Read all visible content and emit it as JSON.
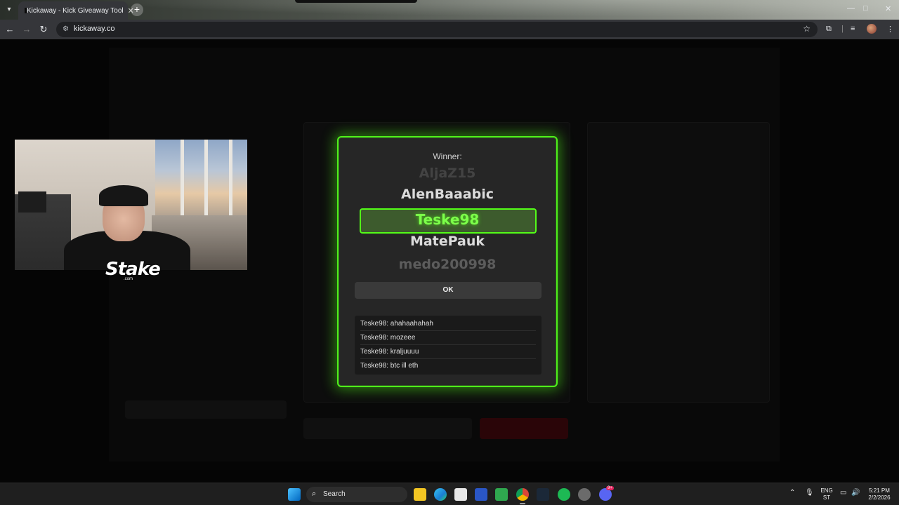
{
  "browser": {
    "tab_title": "Kickaway - Kick Giveaway Tool",
    "url": "kickaway.co",
    "new_tab": "+"
  },
  "webcam": {
    "logo": "Stake",
    "logo_sub": ".com"
  },
  "modal": {
    "title": "Winner:",
    "reel": [
      "AljaZ15",
      "AlenBaaabic",
      "Teske98",
      "MatePauk",
      "medo200998"
    ],
    "winner": "Teske98",
    "ok_label": "OK",
    "chat": [
      "Teske98: ahahaahahah",
      "Teske98: mozeee",
      "Teske98: kraljuuuu",
      "Teske98: btc ill eth"
    ]
  },
  "taskbar": {
    "search_label": "Search",
    "lang_top": "ENG",
    "lang_bottom": "ST",
    "time": "5:21 PM",
    "date": "2/2/2026",
    "discord_badge": "9+"
  },
  "colors": {
    "accent": "#53fc18",
    "modal_bg": "#262626"
  }
}
